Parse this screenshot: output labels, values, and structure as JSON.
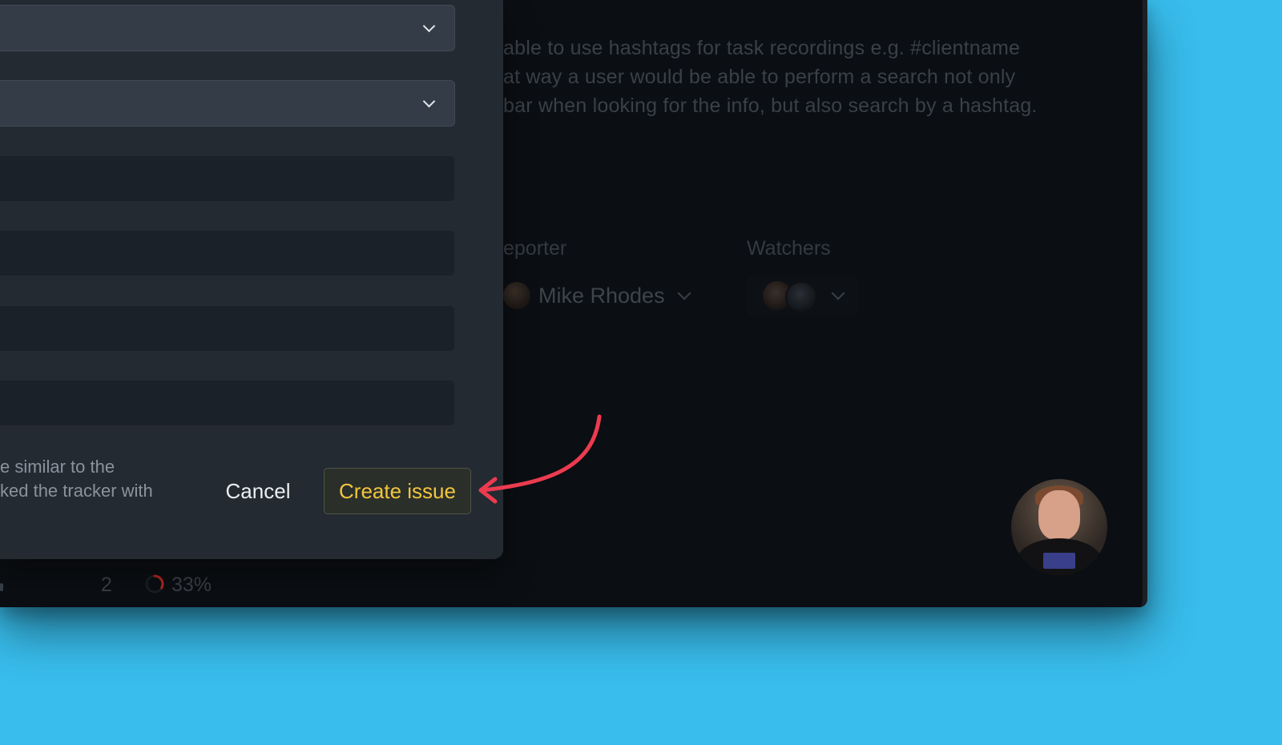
{
  "background": {
    "description_lines": [
      "able to use hashtags for task recordings e.g. #clientname",
      "at way a user would be able to perform a search not only",
      "bar when looking for the info, but also search by a hashtag."
    ],
    "reporter_label": "eporter",
    "reporter_name": "Mike Rhodes",
    "watchers_label": "Watchers",
    "bottom_stats": {
      "count": "2",
      "progress_text": "33%",
      "progress_value": 0.33,
      "progress_color": "#b3261e"
    }
  },
  "modal": {
    "footer_note_lines": [
      "e similar to the",
      "ked the tracker with"
    ],
    "cancel_label": "Cancel",
    "create_label": "Create issue",
    "create_text_color": "#f2c53d"
  },
  "annotation": {
    "arrow_color": "#ec3b4f"
  },
  "icons": {
    "select_chevron": "chevron-down-icon",
    "reporter_chevron": "chevron-down-icon",
    "watchers_chevron": "chevron-down-icon",
    "progress": "progress-ring-icon",
    "arrow": "curved-arrow-icon"
  }
}
